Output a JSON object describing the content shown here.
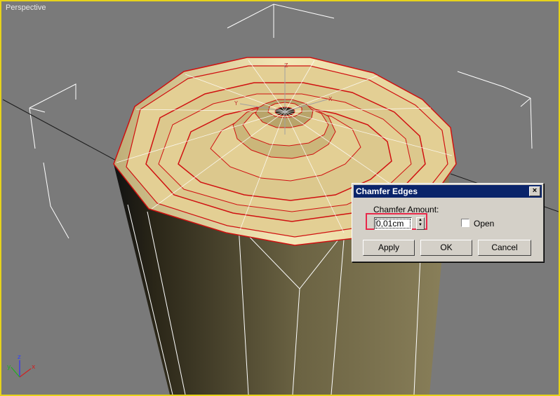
{
  "viewport": {
    "label": "Perspective",
    "border_color": "#e6d21a",
    "background": "#7a7a7a",
    "axis_labels": {
      "x": "x",
      "y": "y",
      "z": "z"
    },
    "pivot_labels": {
      "x": "X",
      "y": "Y",
      "z": "Z"
    }
  },
  "colors": {
    "mesh_top": "#e3cf94",
    "mesh_side_light": "#746b47",
    "mesh_side_dark": "#151410",
    "selected_edges": "#d01010",
    "wire": "#ffffff"
  },
  "dialog": {
    "title": "Chamfer Edges",
    "close_glyph": "×",
    "amount_label": "Chamfer Amount:",
    "amount_value": "0,01cm",
    "spinner_up": "▲",
    "spinner_down": "▼",
    "open_label": "Open",
    "open_checked": false,
    "apply_label": "Apply",
    "ok_label": "OK",
    "cancel_label": "Cancel",
    "highlight_color": "#e8284a"
  }
}
